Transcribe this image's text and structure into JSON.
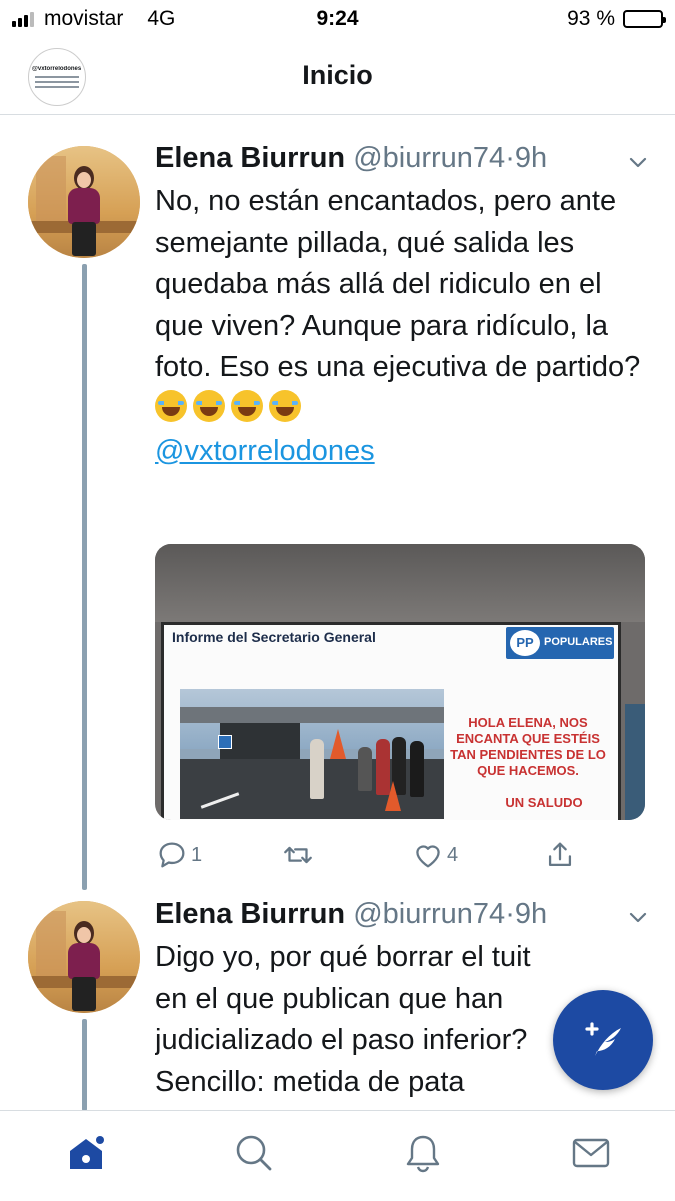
{
  "status_bar": {
    "carrier": "movistar",
    "network": "4G",
    "time": "9:24",
    "battery": "93 %",
    "battery_level": 0.93
  },
  "nav": {
    "title": "Inicio",
    "profile_avatar_text": "@vxtorrelodones te bloqueó"
  },
  "tweets": [
    {
      "name": "Elena Biurrun",
      "handle": "@biurrun74",
      "separator": "·",
      "time": "9h",
      "text": "No, no están encantados, pero ante semejante pillada, qué salida les quedaba más allá del ridiculo en el que viven? Aunque para ridículo, la foto. Eso es una ejecutiva de partido?",
      "emoji_count": 4,
      "mention": "@vxtorrelodones",
      "media": {
        "slide_title": "Informe del Secretario General",
        "logo_initials": "PP",
        "logo_text": "POPULARES",
        "message": "HOLA ELENA, NOS ENCANTA QUE ESTÉIS TAN PENDIENTES DE LO QUE HACEMOS.",
        "saludo": "UN SALUDO"
      },
      "replies": "1",
      "likes": "4"
    },
    {
      "name": "Elena Biurrun",
      "handle": "@biurrun74",
      "separator": "·",
      "time": "9h",
      "lines": [
        "Digo yo, por qué borrar el tuit",
        "en el que publican que han",
        "judicializado el paso inferior?",
        "Sencillo: metida de pata"
      ]
    }
  ],
  "colors": {
    "link": "#1b95e0",
    "fab": "#1d4aa3",
    "tab_active": "#1d4aa3",
    "muted": "#657786"
  },
  "tabs": [
    "home-icon",
    "search-icon",
    "notifications-icon",
    "messages-icon"
  ]
}
